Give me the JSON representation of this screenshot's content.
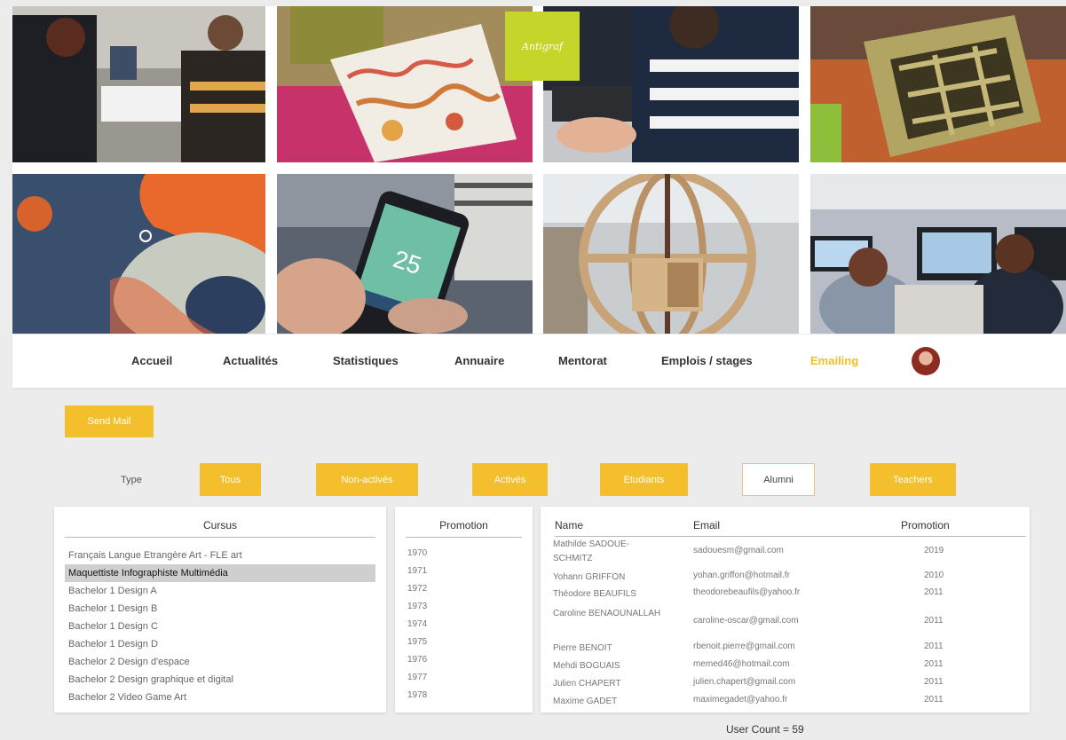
{
  "logo": {
    "text": "Antigraf"
  },
  "nav": {
    "items": [
      "Accueil",
      "Actualités",
      "Statistiques",
      "Annuaire",
      "Mentorat",
      "Emplois / stages",
      "Emailing"
    ],
    "active_index": 6
  },
  "send_mail_label": "Send Mail",
  "filters": {
    "type_label": "Type",
    "buttons": [
      "Tous",
      "Non-activés",
      "Activés",
      "Etudiants",
      "Alumni",
      "Teachers"
    ],
    "selected": "Alumni"
  },
  "cursus": {
    "header": "Cursus",
    "items": [
      "Français Langue Etrangère Art - FLE art",
      "Maquettiste Infographiste Multimédia",
      "Bachelor 1 Design A",
      "Bachelor 1 Design B",
      "Bachelor 1 Design C",
      "Bachelor 1 Design D",
      "Bachelor 2 Design d'espace",
      "Bachelor 2 Design graphique et digital",
      "Bachelor 2 Video Game Art"
    ],
    "selected_index": 1
  },
  "promotion": {
    "header": "Promotion",
    "items": [
      "1970",
      "1971",
      "1972",
      "1973",
      "1974",
      "1975",
      "1976",
      "1977",
      "1978"
    ]
  },
  "users": {
    "headers": {
      "name": "Name",
      "email": "Email",
      "promotion": "Promotion"
    },
    "rows": [
      {
        "name": "Mathilde SADOUE-SCHMITZ",
        "email": "sadouesm@gmail.com",
        "promotion": "2019"
      },
      {
        "name": "Yohann GRIFFON",
        "email": "yohan.griffon@hotmail.fr",
        "promotion": "2010"
      },
      {
        "name": "Théodore BEAUFILS",
        "email": "theodorebeaufils@yahoo.fr",
        "promotion": "2011"
      },
      {
        "name": "Caroline BENAOUNALLAH",
        "email": "caroline-oscar@gmail.com",
        "promotion": "2011"
      },
      {
        "name": "Pierre BENOIT",
        "email": "rbenoit.pierre@gmail.com",
        "promotion": "2011"
      },
      {
        "name": "Mehdi BOGUAIS",
        "email": "memed46@hotmail.com",
        "promotion": "2011"
      },
      {
        "name": "Julien CHAPERT",
        "email": "julien.chapert@gmail.com",
        "promotion": "2011"
      },
      {
        "name": "Maxime GADET",
        "email": "maximegadet@yahoo.fr",
        "promotion": "2011"
      }
    ]
  },
  "user_count": "User Count = 59",
  "colors": {
    "accent": "#f3bf2c",
    "logo_green": "#c5d52a"
  }
}
